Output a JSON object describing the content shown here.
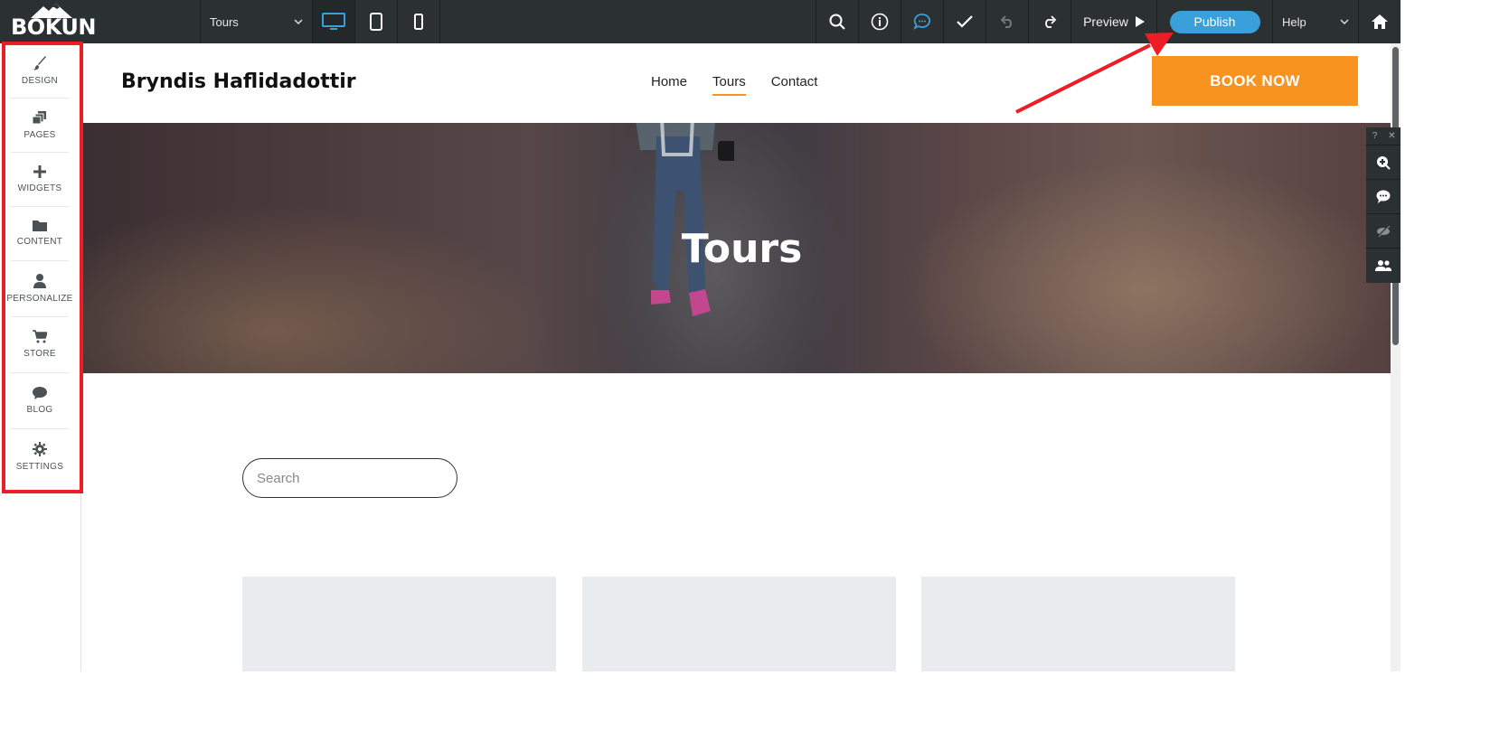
{
  "toolbar": {
    "logo": "BÓKUN",
    "page_select": "Tours",
    "preview_label": "Preview",
    "publish_label": "Publish",
    "help_label": "Help"
  },
  "sidebar": {
    "items": [
      {
        "label": "DESIGN",
        "icon": "brush-icon"
      },
      {
        "label": "PAGES",
        "icon": "pages-icon"
      },
      {
        "label": "WIDGETS",
        "icon": "plus-icon"
      },
      {
        "label": "CONTENT",
        "icon": "folder-icon"
      },
      {
        "label": "PERSONALIZE",
        "icon": "person-icon"
      },
      {
        "label": "STORE",
        "icon": "cart-icon"
      },
      {
        "label": "BLOG",
        "icon": "chat-bubble-icon"
      },
      {
        "label": "SETTINGS",
        "icon": "gear-icon"
      }
    ]
  },
  "site": {
    "brand": "Bryndis Haflidadottir",
    "nav": [
      "Home",
      "Tours",
      "Contact"
    ],
    "active_nav": "Tours",
    "book_label": "BOOK NOW",
    "hero_title": "Tours",
    "search_placeholder": "Search"
  },
  "float_panel": {
    "top": [
      "?",
      "✕"
    ]
  },
  "colors": {
    "toolbar_bg": "#2b3032",
    "publish_blue": "#3aa0dc",
    "book_orange": "#f7931e",
    "annotation_red": "#ee1c24"
  }
}
